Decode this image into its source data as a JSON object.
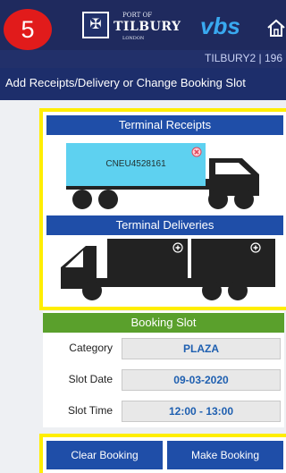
{
  "step_badge": "5",
  "header": {
    "logo_small_top": "PORT OF",
    "logo_main": "TILBURY",
    "logo_small_bottom": "LONDON",
    "vbs_logo": "vbs",
    "session": "TILBURY2 | 196"
  },
  "page_title": "Add Receipts/Delivery or Change Booking Slot",
  "receipts": {
    "title": "Terminal Receipts",
    "container_id": "CNEU4528161"
  },
  "deliveries": {
    "title": "Terminal Deliveries"
  },
  "booking_slot": {
    "title": "Booking Slot",
    "fields": [
      {
        "label": "Category",
        "value": "PLAZA"
      },
      {
        "label": "Slot Date",
        "value": "09-03-2020"
      },
      {
        "label": "Slot Time",
        "value": "12:00 - 13:00"
      }
    ]
  },
  "actions": {
    "clear_label": "Clear Booking",
    "make_label": "Make Booking"
  },
  "colors": {
    "navy": "#1f2a5e",
    "panel_blue": "#1f4ea8",
    "container_cyan": "#5ed1f0",
    "highlight_yellow": "#ffee00",
    "slot_green": "#5aa02c",
    "badge_red": "#e11b1b"
  }
}
